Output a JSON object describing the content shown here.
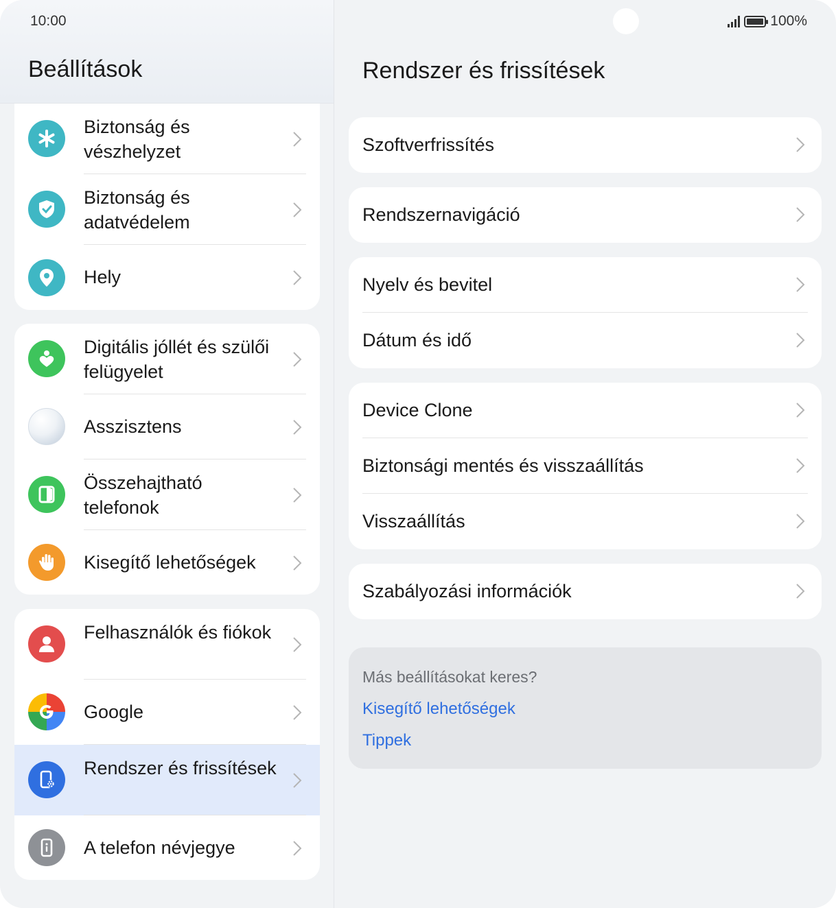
{
  "status_bar": {
    "time": "10:00",
    "battery_pct": "100%"
  },
  "left": {
    "title": "Beállítások",
    "groups": [
      {
        "items": [
          {
            "label": "Biztonság és vészhelyzet",
            "icon": "asterisk-icon",
            "color": "#3fb7c4"
          },
          {
            "label": "Biztonság és adatvédelem",
            "icon": "shield-check-icon",
            "color": "#3fb7c4"
          },
          {
            "label": "Hely",
            "icon": "location-pin-icon",
            "color": "#3fb7c4"
          }
        ]
      },
      {
        "items": [
          {
            "label": "Digitális jóllét és szülői felügyelet",
            "icon": "heart-person-icon",
            "color": "#3ec45c"
          },
          {
            "label": "Asszisztens",
            "icon": "assistant-orb-icon",
            "color": "#dfe6ef"
          },
          {
            "label": "Összehajtható telefonok",
            "icon": "foldable-phone-icon",
            "color": "#3ec45c"
          },
          {
            "label": "Kisegítő lehetőségek",
            "icon": "hand-icon",
            "color": "#f39a2c"
          }
        ]
      },
      {
        "items": [
          {
            "label": "Felhasználók és fiókok",
            "icon": "user-icon",
            "color": "#e34d4d"
          },
          {
            "label": "Google",
            "icon": "google-icon",
            "color": "#4285f4"
          },
          {
            "label": "Rendszer és frissítések",
            "icon": "system-update-icon",
            "color": "#2f6fe0",
            "selected": true
          },
          {
            "label": "A telefon névjegye",
            "icon": "info-phone-icon",
            "color": "#8e9196"
          }
        ]
      }
    ]
  },
  "right": {
    "title": "Rendszer és frissítések",
    "groups": [
      {
        "items": [
          "Szoftverfrissítés"
        ]
      },
      {
        "items": [
          "Rendszernavigáció"
        ]
      },
      {
        "items": [
          "Nyelv és bevitel",
          "Dátum és idő"
        ]
      },
      {
        "items": [
          "Device Clone",
          "Biztonsági mentés és visszaállítás",
          "Visszaállítás"
        ]
      },
      {
        "items": [
          "Szabályozási információk"
        ]
      }
    ],
    "suggest": {
      "question": "Más beállításokat keres?",
      "links": [
        "Kisegítő lehetőségek",
        "Tippek"
      ]
    }
  }
}
